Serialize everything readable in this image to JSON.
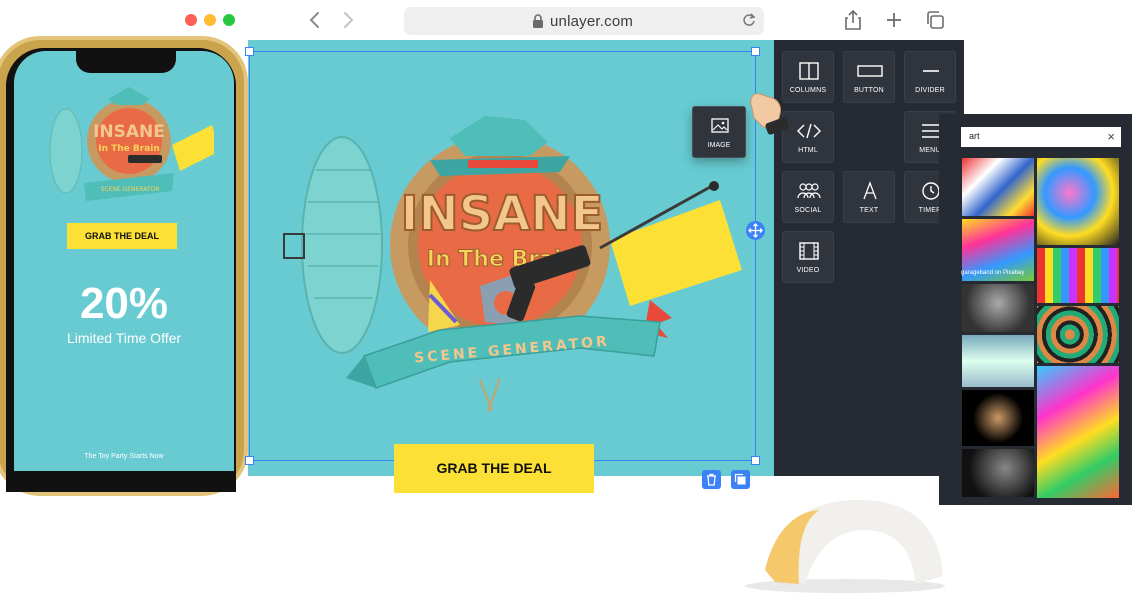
{
  "browser": {
    "url": "unlayer.com",
    "icons": {
      "back": "chevron-left-icon",
      "forward": "chevron-right-icon",
      "lock": "lock-icon",
      "reload": "reload-icon",
      "share": "share-icon",
      "new_tab": "plus-icon",
      "tabs": "tabs-icon"
    },
    "traffic_colors": [
      "#fe5f57",
      "#febc2e",
      "#28c840"
    ]
  },
  "phone_preview": {
    "art_text": {
      "line1": "INSANE",
      "line2": "In The Brain",
      "ribbon": "SCENE GENERATOR"
    },
    "cta": "GRAB THE DEAL",
    "percent": "20%",
    "offer": "Limited Time Offer",
    "footer": "The Toy Party Starts Now"
  },
  "canvas": {
    "background": "#67cbd1",
    "hero": {
      "line1": "INSANE",
      "line2": "In The Brain",
      "ribbon": "SCENE GENERATOR"
    },
    "cta": "GRAB THE DEAL",
    "actions": {
      "delete": "trash-icon",
      "duplicate": "duplicate-icon",
      "move": "move-icon"
    },
    "accent": "#3b82f6",
    "cta_color": "#fde036"
  },
  "tools_panel": {
    "items": [
      {
        "label": "COLUMNS",
        "icon": "columns-icon"
      },
      {
        "label": "BUTTON",
        "icon": "button-icon"
      },
      {
        "label": "DIVIDER",
        "icon": "divider-icon"
      },
      {
        "label": "HTML",
        "icon": "code-icon"
      },
      {
        "label": "MENU",
        "icon": "menu-icon"
      },
      {
        "label": "SOCIAL",
        "icon": "social-icon"
      },
      {
        "label": "TEXT",
        "icon": "text-icon"
      },
      {
        "label": "TIMER",
        "icon": "clock-icon"
      },
      {
        "label": "VIDEO",
        "icon": "film-icon"
      }
    ],
    "dragging": {
      "label": "IMAGE",
      "icon": "image-icon"
    }
  },
  "image_search": {
    "query": "art",
    "clear_icon": "close-icon",
    "credit": "garageband on Pixabay"
  }
}
